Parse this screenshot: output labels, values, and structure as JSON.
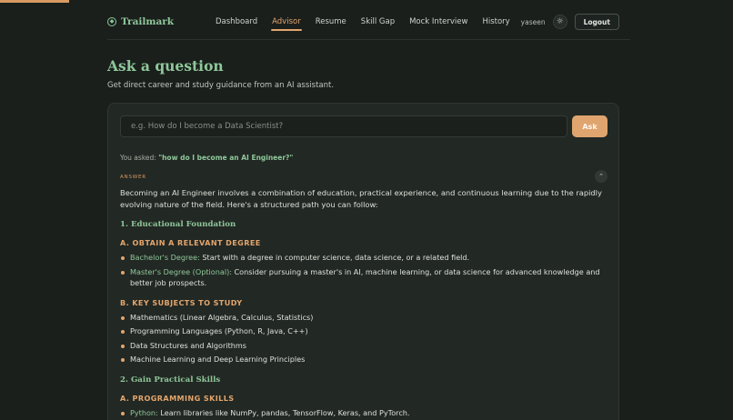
{
  "app": {
    "brand": "Trailmark",
    "brand_icon": "compass-icon"
  },
  "nav": {
    "items": [
      {
        "label": "Dashboard"
      },
      {
        "label": "Advisor",
        "active": true
      },
      {
        "label": "Resume"
      },
      {
        "label": "Skill Gap"
      },
      {
        "label": "Mock Interview"
      },
      {
        "label": "History"
      }
    ]
  },
  "user": {
    "name": "yaseen",
    "theme_icon": "sun-icon",
    "logout_label": "Logout"
  },
  "page": {
    "title": "Ask a question",
    "subtitle": "Get direct career and study guidance from an AI assistant."
  },
  "ask": {
    "placeholder": "e.g. How do I become a Data Scientist?",
    "value": "",
    "button_label": "Ask"
  },
  "result": {
    "asked_prefix": "You asked:",
    "asked_question": "\"how do I become an AI Engineer?\"",
    "answer_label": "ANSWER",
    "collapse_icon": "chevron-up-icon",
    "intro": "Becoming an AI Engineer involves a combination of education, practical experience, and continuous learning due to the rapidly evolving nature of the field. Here's a structured path you can follow:",
    "section1": {
      "heading": "1. Educational Foundation",
      "subA": {
        "heading": "A. OBTAIN A RELEVANT DEGREE",
        "items": [
          {
            "term": "Bachelor's Degree:",
            "text": " Start with a degree in computer science, data science, or a related field."
          },
          {
            "term": "Master's Degree (Optional):",
            "text": " Consider pursuing a master's in AI, machine learning, or data science for advanced knowledge and better job prospects."
          }
        ]
      },
      "subB": {
        "heading": "B. KEY SUBJECTS TO STUDY",
        "items": [
          "Mathematics (Linear Algebra, Calculus, Statistics)",
          "Programming Languages (Python, R, Java, C++)",
          "Data Structures and Algorithms",
          "Machine Learning and Deep Learning Principles"
        ]
      }
    },
    "section2": {
      "heading": "2. Gain Practical Skills",
      "subA": {
        "heading": "A. PROGRAMMING SKILLS",
        "items": [
          {
            "term": "Python:",
            "text": " Learn libraries like NumPy, pandas, TensorFlow, Keras, and PyTorch."
          }
        ]
      }
    }
  },
  "colors": {
    "background": "#1a1f1c",
    "accent_green": "#8fc79a",
    "accent_orange": "#e3a56c",
    "card": "#222824"
  }
}
